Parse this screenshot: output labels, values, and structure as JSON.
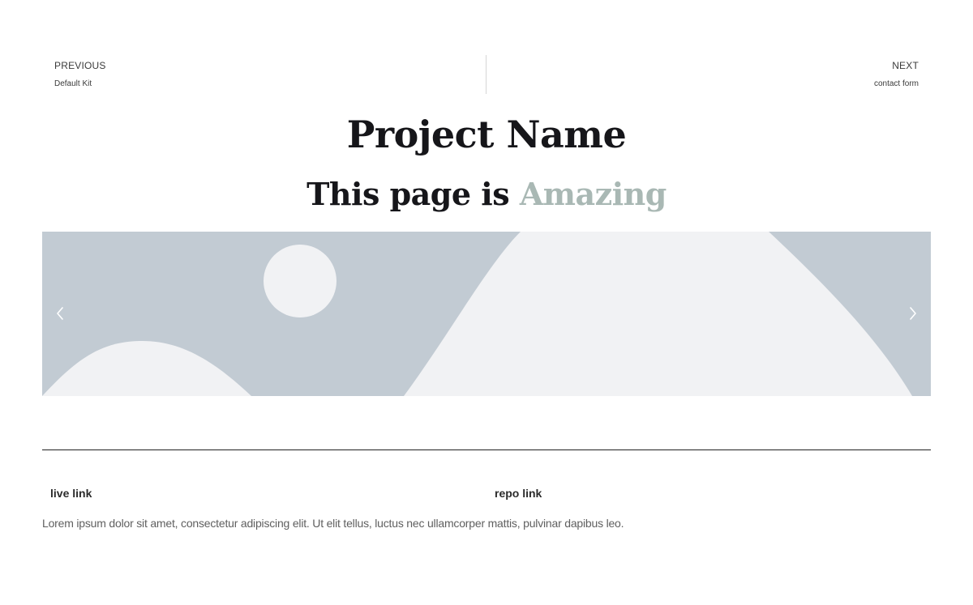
{
  "post_nav": {
    "previous": {
      "label": "PREVIOUS",
      "title": "Default Kit"
    },
    "next": {
      "label": "NEXT",
      "title": "contact form"
    }
  },
  "header": {
    "title": "Project Name",
    "tagline_prefix": "This page is",
    "tagline_highlight": "Amazing"
  },
  "slider": {
    "prev_icon": "chevron-left-icon",
    "next_icon": "chevron-right-icon",
    "image_icon": "image-placeholder"
  },
  "links": {
    "live_link": "live link",
    "repo_link": "repo link"
  },
  "description": "Lorem ipsum dolor sit amet, consectetur adipiscing elit. Ut elit tellus, luctus nec ullamcorper mattis, pulvinar dapibus leo.",
  "colors": {
    "heading": "#16161a",
    "accent": "#a9b8b4",
    "placeholder_bg": "#c2cbd3",
    "placeholder_shape": "#f1f2f4",
    "divider": "#222222"
  }
}
